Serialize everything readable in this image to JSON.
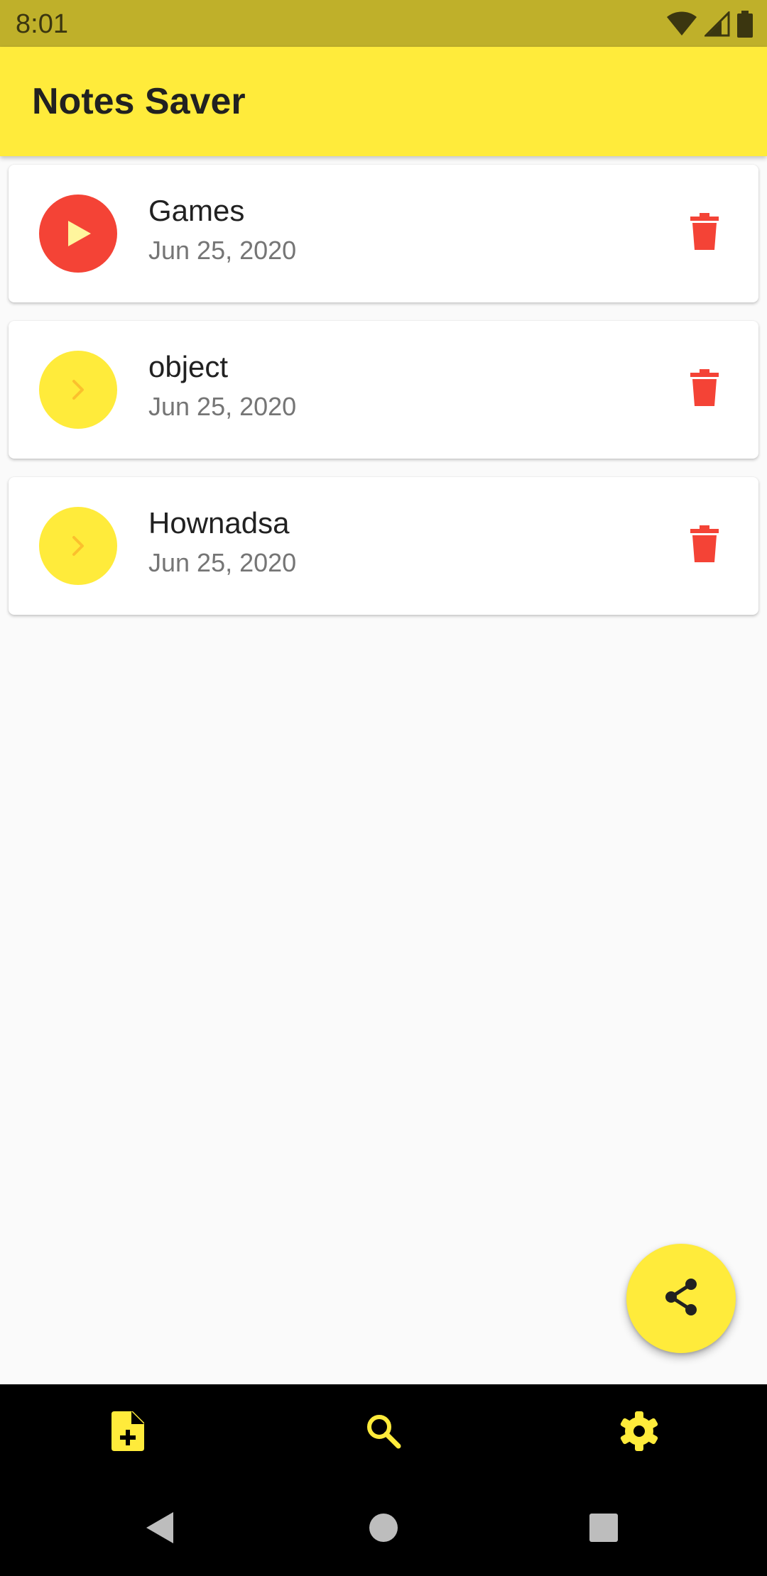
{
  "status_bar": {
    "time": "8:01",
    "icons": [
      "wifi-icon",
      "signal-icon",
      "battery-icon"
    ]
  },
  "app_bar": {
    "title": "Notes Saver",
    "color": "#ffeb3b"
  },
  "notes": [
    {
      "title": "Games",
      "date": "Jun 25, 2020",
      "avatar_icon": "play-icon",
      "avatar_color": "#f44336",
      "action_icon": "delete-icon"
    },
    {
      "title": "object",
      "date": "Jun 25, 2020",
      "avatar_icon": "chevron-right-icon",
      "avatar_color": "#ffeb3b",
      "action_icon": "delete-icon"
    },
    {
      "title": "Hownadsa",
      "date": "Jun 25, 2020",
      "avatar_icon": "chevron-right-icon",
      "avatar_color": "#ffeb3b",
      "action_icon": "delete-icon"
    }
  ],
  "fab": {
    "icon": "share-icon",
    "color": "#ffeb3b"
  },
  "bottom_nav": {
    "items": [
      {
        "icon": "note-add-icon"
      },
      {
        "icon": "search-icon"
      },
      {
        "icon": "settings-icon"
      }
    ],
    "accent": "#ffeb3b"
  },
  "system_nav": {
    "items": [
      {
        "icon": "back-icon"
      },
      {
        "icon": "home-icon"
      },
      {
        "icon": "recents-icon"
      }
    ]
  },
  "colors": {
    "delete": "#f44336",
    "background": "#fafafa"
  }
}
